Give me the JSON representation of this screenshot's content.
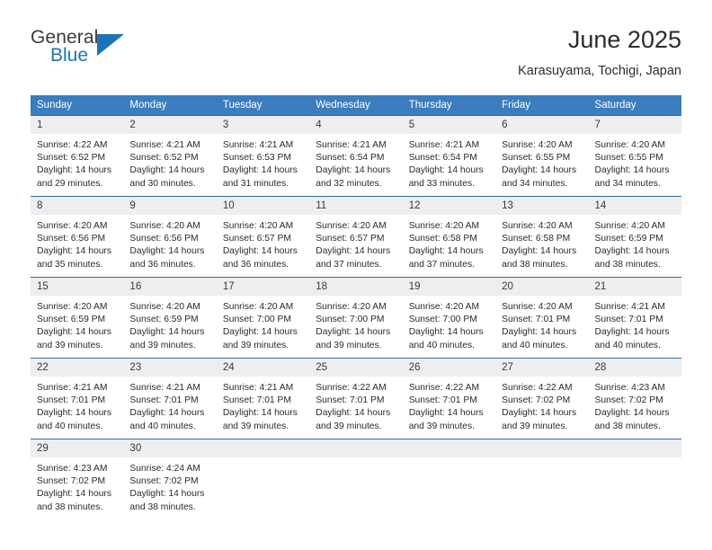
{
  "brand": {
    "name_top": "General",
    "name_bottom": "Blue",
    "color_dark": "#3b3b3b",
    "color_blue": "#1b74b8"
  },
  "header": {
    "month_title": "June 2025",
    "location": "Karasuyama, Tochigi, Japan"
  },
  "theme": {
    "header_band": "#3b7dbf",
    "row_rule": "#2e6da4",
    "daynum_strip": "#eeeeee"
  },
  "weekday_headers": [
    "Sunday",
    "Monday",
    "Tuesday",
    "Wednesday",
    "Thursday",
    "Friday",
    "Saturday"
  ],
  "weeks": [
    [
      {
        "day": "1",
        "sunrise": "Sunrise: 4:22 AM",
        "sunset": "Sunset: 6:52 PM",
        "daylight": "Daylight: 14 hours and 29 minutes."
      },
      {
        "day": "2",
        "sunrise": "Sunrise: 4:21 AM",
        "sunset": "Sunset: 6:52 PM",
        "daylight": "Daylight: 14 hours and 30 minutes."
      },
      {
        "day": "3",
        "sunrise": "Sunrise: 4:21 AM",
        "sunset": "Sunset: 6:53 PM",
        "daylight": "Daylight: 14 hours and 31 minutes."
      },
      {
        "day": "4",
        "sunrise": "Sunrise: 4:21 AM",
        "sunset": "Sunset: 6:54 PM",
        "daylight": "Daylight: 14 hours and 32 minutes."
      },
      {
        "day": "5",
        "sunrise": "Sunrise: 4:21 AM",
        "sunset": "Sunset: 6:54 PM",
        "daylight": "Daylight: 14 hours and 33 minutes."
      },
      {
        "day": "6",
        "sunrise": "Sunrise: 4:20 AM",
        "sunset": "Sunset: 6:55 PM",
        "daylight": "Daylight: 14 hours and 34 minutes."
      },
      {
        "day": "7",
        "sunrise": "Sunrise: 4:20 AM",
        "sunset": "Sunset: 6:55 PM",
        "daylight": "Daylight: 14 hours and 34 minutes."
      }
    ],
    [
      {
        "day": "8",
        "sunrise": "Sunrise: 4:20 AM",
        "sunset": "Sunset: 6:56 PM",
        "daylight": "Daylight: 14 hours and 35 minutes."
      },
      {
        "day": "9",
        "sunrise": "Sunrise: 4:20 AM",
        "sunset": "Sunset: 6:56 PM",
        "daylight": "Daylight: 14 hours and 36 minutes."
      },
      {
        "day": "10",
        "sunrise": "Sunrise: 4:20 AM",
        "sunset": "Sunset: 6:57 PM",
        "daylight": "Daylight: 14 hours and 36 minutes."
      },
      {
        "day": "11",
        "sunrise": "Sunrise: 4:20 AM",
        "sunset": "Sunset: 6:57 PM",
        "daylight": "Daylight: 14 hours and 37 minutes."
      },
      {
        "day": "12",
        "sunrise": "Sunrise: 4:20 AM",
        "sunset": "Sunset: 6:58 PM",
        "daylight": "Daylight: 14 hours and 37 minutes."
      },
      {
        "day": "13",
        "sunrise": "Sunrise: 4:20 AM",
        "sunset": "Sunset: 6:58 PM",
        "daylight": "Daylight: 14 hours and 38 minutes."
      },
      {
        "day": "14",
        "sunrise": "Sunrise: 4:20 AM",
        "sunset": "Sunset: 6:59 PM",
        "daylight": "Daylight: 14 hours and 38 minutes."
      }
    ],
    [
      {
        "day": "15",
        "sunrise": "Sunrise: 4:20 AM",
        "sunset": "Sunset: 6:59 PM",
        "daylight": "Daylight: 14 hours and 39 minutes."
      },
      {
        "day": "16",
        "sunrise": "Sunrise: 4:20 AM",
        "sunset": "Sunset: 6:59 PM",
        "daylight": "Daylight: 14 hours and 39 minutes."
      },
      {
        "day": "17",
        "sunrise": "Sunrise: 4:20 AM",
        "sunset": "Sunset: 7:00 PM",
        "daylight": "Daylight: 14 hours and 39 minutes."
      },
      {
        "day": "18",
        "sunrise": "Sunrise: 4:20 AM",
        "sunset": "Sunset: 7:00 PM",
        "daylight": "Daylight: 14 hours and 39 minutes."
      },
      {
        "day": "19",
        "sunrise": "Sunrise: 4:20 AM",
        "sunset": "Sunset: 7:00 PM",
        "daylight": "Daylight: 14 hours and 40 minutes."
      },
      {
        "day": "20",
        "sunrise": "Sunrise: 4:20 AM",
        "sunset": "Sunset: 7:01 PM",
        "daylight": "Daylight: 14 hours and 40 minutes."
      },
      {
        "day": "21",
        "sunrise": "Sunrise: 4:21 AM",
        "sunset": "Sunset: 7:01 PM",
        "daylight": "Daylight: 14 hours and 40 minutes."
      }
    ],
    [
      {
        "day": "22",
        "sunrise": "Sunrise: 4:21 AM",
        "sunset": "Sunset: 7:01 PM",
        "daylight": "Daylight: 14 hours and 40 minutes."
      },
      {
        "day": "23",
        "sunrise": "Sunrise: 4:21 AM",
        "sunset": "Sunset: 7:01 PM",
        "daylight": "Daylight: 14 hours and 40 minutes."
      },
      {
        "day": "24",
        "sunrise": "Sunrise: 4:21 AM",
        "sunset": "Sunset: 7:01 PM",
        "daylight": "Daylight: 14 hours and 39 minutes."
      },
      {
        "day": "25",
        "sunrise": "Sunrise: 4:22 AM",
        "sunset": "Sunset: 7:01 PM",
        "daylight": "Daylight: 14 hours and 39 minutes."
      },
      {
        "day": "26",
        "sunrise": "Sunrise: 4:22 AM",
        "sunset": "Sunset: 7:01 PM",
        "daylight": "Daylight: 14 hours and 39 minutes."
      },
      {
        "day": "27",
        "sunrise": "Sunrise: 4:22 AM",
        "sunset": "Sunset: 7:02 PM",
        "daylight": "Daylight: 14 hours and 39 minutes."
      },
      {
        "day": "28",
        "sunrise": "Sunrise: 4:23 AM",
        "sunset": "Sunset: 7:02 PM",
        "daylight": "Daylight: 14 hours and 38 minutes."
      }
    ],
    [
      {
        "day": "29",
        "sunrise": "Sunrise: 4:23 AM",
        "sunset": "Sunset: 7:02 PM",
        "daylight": "Daylight: 14 hours and 38 minutes."
      },
      {
        "day": "30",
        "sunrise": "Sunrise: 4:24 AM",
        "sunset": "Sunset: 7:02 PM",
        "daylight": "Daylight: 14 hours and 38 minutes."
      },
      {
        "day": "",
        "sunrise": "",
        "sunset": "",
        "daylight": ""
      },
      {
        "day": "",
        "sunrise": "",
        "sunset": "",
        "daylight": ""
      },
      {
        "day": "",
        "sunrise": "",
        "sunset": "",
        "daylight": ""
      },
      {
        "day": "",
        "sunrise": "",
        "sunset": "",
        "daylight": ""
      },
      {
        "day": "",
        "sunrise": "",
        "sunset": "",
        "daylight": ""
      }
    ]
  ]
}
